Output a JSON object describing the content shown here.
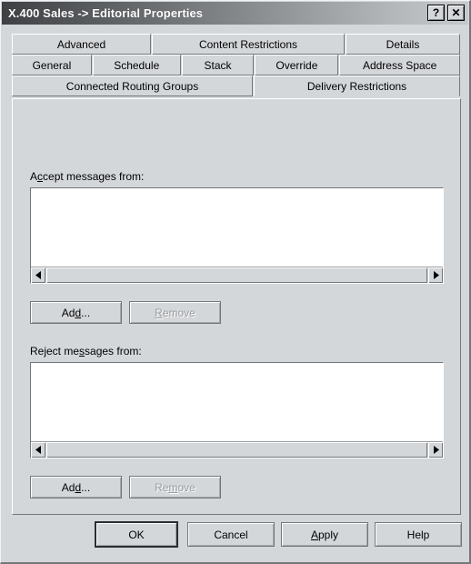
{
  "window": {
    "title": "X.400 Sales -> Editorial Properties",
    "help_button": "?",
    "close_button": "✕",
    "bg_color": "#d4d7da",
    "titlebar_start": "#3f4043",
    "titlebar_end": "#c6c9cc"
  },
  "tabs": {
    "rows": [
      [
        {
          "label": "Advanced",
          "active": false
        },
        {
          "label": "Content Restrictions",
          "active": false
        },
        {
          "label": "Details",
          "active": false
        }
      ],
      [
        {
          "label": "General",
          "active": false
        },
        {
          "label": "Schedule",
          "active": false
        },
        {
          "label": "Stack",
          "active": false
        },
        {
          "label": "Override",
          "active": false
        },
        {
          "label": "Address Space",
          "active": false
        }
      ],
      [
        {
          "label": "Connected Routing Groups",
          "active": false
        },
        {
          "label": "Delivery Restrictions",
          "active": true
        }
      ]
    ],
    "selected": "Delivery Restrictions"
  },
  "panel": {
    "accept": {
      "label_before": "A",
      "label_accel": "c",
      "label_after": "cept messages from:",
      "full_label": "Accept messages from:",
      "list_items": [],
      "add_label_before": "Ad",
      "add_label_accel": "d",
      "add_label_after": "...",
      "add_full": "Add...",
      "remove_label_accel": "R",
      "remove_label_after": "emove",
      "remove_full": "Remove",
      "remove_enabled": false
    },
    "reject": {
      "label_before": "Reject me",
      "label_accel": "s",
      "label_after": "sages from:",
      "full_label": "Reject messages from:",
      "list_items": [],
      "add_label_before": "Ad",
      "add_label_accel": "d",
      "add_label_after": "...",
      "add_full": "Add...",
      "remove_label_before": "Re",
      "remove_label_accel": "m",
      "remove_label_after": "ove",
      "remove_full": "Remove",
      "remove_enabled": false
    }
  },
  "footer": {
    "ok": "OK",
    "cancel": "Cancel",
    "apply_before": "",
    "apply_accel": "A",
    "apply_after": "pply",
    "apply_full": "Apply",
    "help": "Help"
  },
  "scrollbar": {
    "left_arrow": "left-arrow",
    "right_arrow": "right-arrow"
  }
}
